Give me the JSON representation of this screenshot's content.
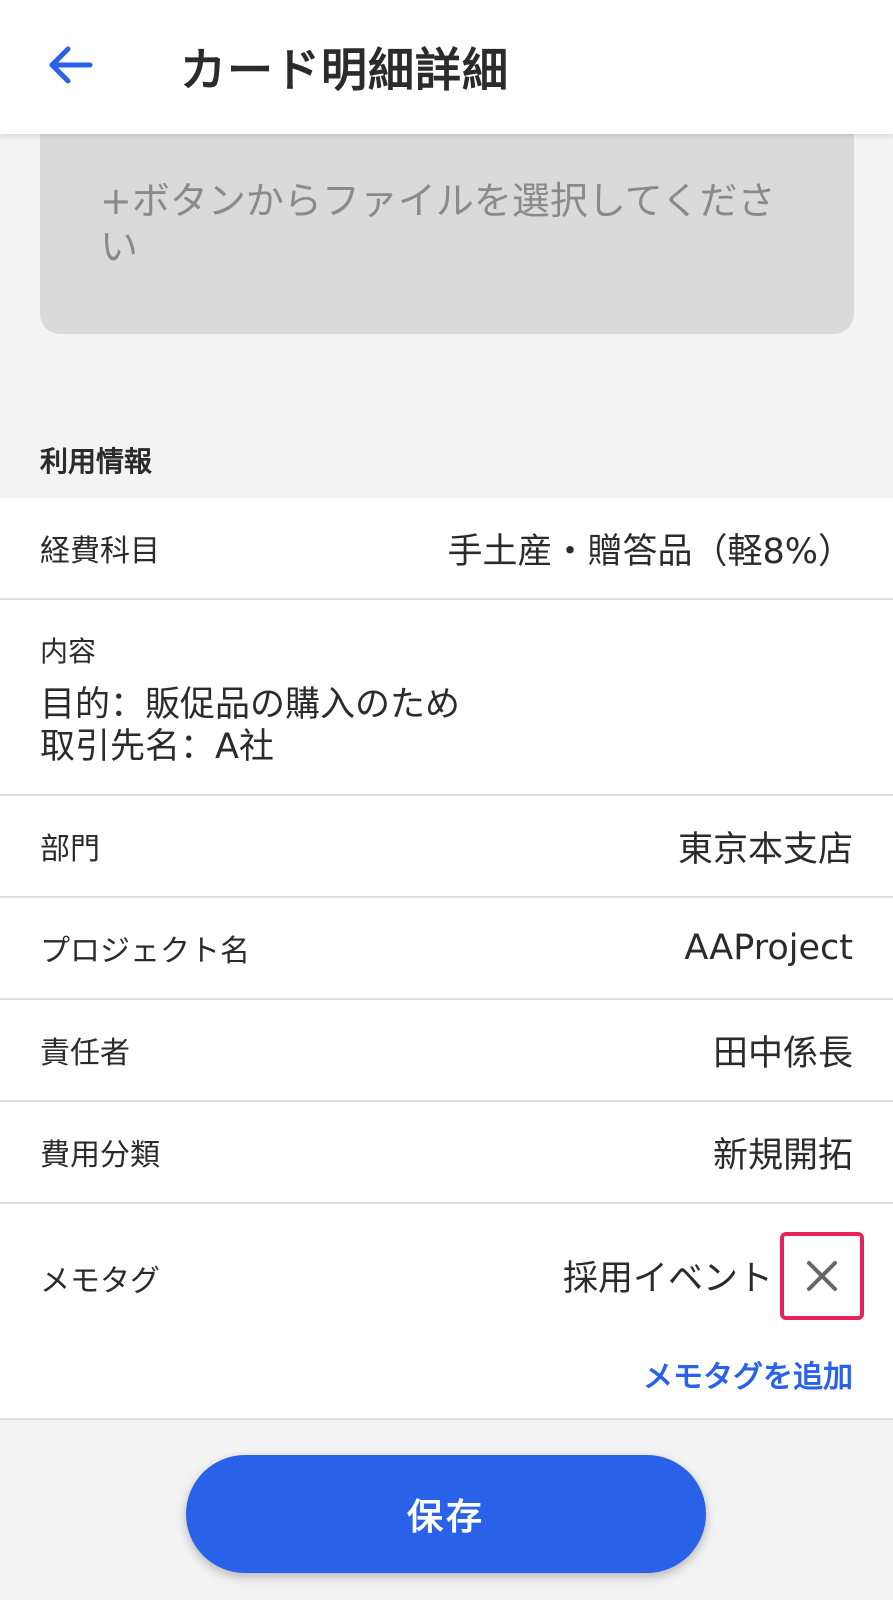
{
  "header": {
    "title": "カード明細詳細",
    "back_icon": "arrow-left-icon",
    "accent_color": "#2962e8"
  },
  "dropzone": {
    "text": "+ボタンからファイルを選択してください"
  },
  "usage_section": {
    "title": "利用情報",
    "rows": [
      {
        "label": "経費科目",
        "value": "手土産・贈答品（軽8%）"
      },
      {
        "label": "部門",
        "value": "東京本支店"
      },
      {
        "label": "プロジェクト名",
        "value": "AAProject"
      },
      {
        "label": "責任者",
        "value": "田中係長"
      },
      {
        "label": "費用分類",
        "value": "新規開拓"
      }
    ],
    "content": {
      "label": "内容",
      "line1": "目的：販促品の購入のため",
      "line2": "取引先名：A社"
    },
    "memo_tag": {
      "label": "メモタグ",
      "value": "採用イベント",
      "remove_icon": "close-icon",
      "highlight_color": "#e8235a",
      "add_link": "メモタグを追加"
    }
  },
  "footer": {
    "save_label": "保存"
  }
}
